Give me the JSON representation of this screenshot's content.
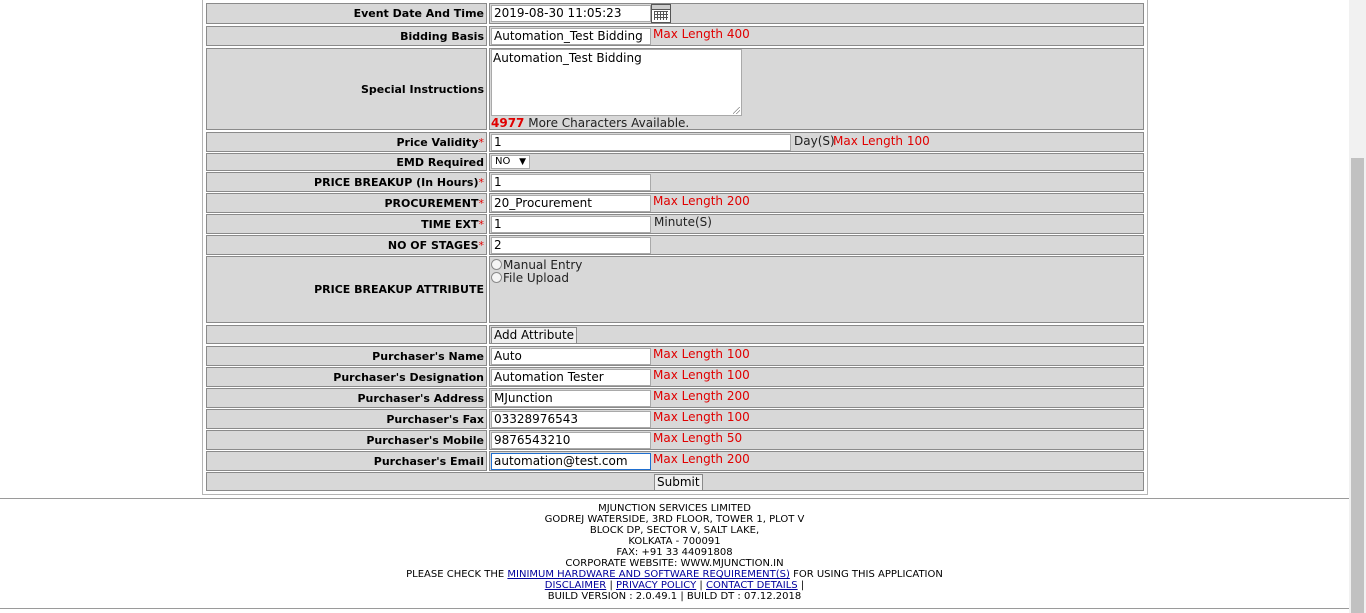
{
  "form": {
    "event_date": {
      "label": "Event Date And Time",
      "value": "2019-08-30 11:05:23"
    },
    "bidding_basis": {
      "label": "Bidding Basis",
      "value": "Automation_Test Bidding",
      "note": "Max Length 400"
    },
    "special_instructions": {
      "label": "Special Instructions",
      "value": "Automation_Test Bidding",
      "remaining_count": "4977",
      "remaining_text": "More Characters Available."
    },
    "price_validity": {
      "label": "Price Validity",
      "required": "*",
      "value": "1",
      "unit": "Day(S)",
      "note": "Max Length 100"
    },
    "emd_required": {
      "label": "EMD Required",
      "selected": "NO"
    },
    "price_breakup_hours": {
      "label": "PRICE BREAKUP (In Hours)",
      "required": "*",
      "value": "1"
    },
    "procurement": {
      "label": "PROCUREMENT",
      "required": "*",
      "value": "20_Procurement",
      "note": "Max Length 200"
    },
    "time_ext": {
      "label": "TIME EXT",
      "required": "*",
      "value": "1",
      "unit": "Minute(S)"
    },
    "no_of_stages": {
      "label": "NO OF STAGES",
      "required": "*",
      "value": "2"
    },
    "price_breakup_attribute": {
      "label": "PRICE BREAKUP ATTRIBUTE",
      "option_manual": "Manual Entry",
      "option_upload": "File Upload"
    },
    "add_attribute_label": "Add Attribute",
    "purchaser_name": {
      "label": "Purchaser's Name",
      "value": "Auto",
      "note": "Max Length 100"
    },
    "purchaser_designation": {
      "label": "Purchaser's Designation",
      "value": "Automation Tester",
      "note": "Max Length 100"
    },
    "purchaser_address": {
      "label": "Purchaser's Address",
      "value": "MJunction",
      "note": "Max Length 200"
    },
    "purchaser_fax": {
      "label": "Purchaser's Fax",
      "value": "03328976543",
      "note": "Max Length 100"
    },
    "purchaser_mobile": {
      "label": "Purchaser's Mobile",
      "value": "9876543210",
      "note": "Max Length 50"
    },
    "purchaser_email": {
      "label": "Purchaser's Email",
      "value": "automation@test.com",
      "note": "Max Length 200"
    },
    "submit_label": "Submit"
  },
  "footer": {
    "company": "MJUNCTION SERVICES LIMITED",
    "address1": "GODREJ WATERSIDE, 3RD FLOOR, TOWER 1, PLOT V",
    "address2": "BLOCK DP, SECTOR V, SALT LAKE,",
    "address3": "KOLKATA - 700091",
    "fax": "FAX: +91 33 44091808",
    "website": "CORPORATE WEBSITE: WWW.MJUNCTION.IN",
    "check_prefix": "PLEASE CHECK THE",
    "check_link": "MINIMUM HARDWARE AND SOFTWARE REQUIREMENT(S)",
    "check_suffix": "FOR USING THIS APPLICATION",
    "disclaimer": "DISCLAIMER",
    "privacy": "PRIVACY POLICY",
    "contact": "CONTACT DETAILS",
    "sep": "|",
    "build": "BUILD VERSION : 2.0.49.1 | BUILD DT : 07.12.2018"
  },
  "colors": {
    "accent_red": "#e00000",
    "row_bg": "#d8d8d8",
    "link": "#00009c"
  }
}
